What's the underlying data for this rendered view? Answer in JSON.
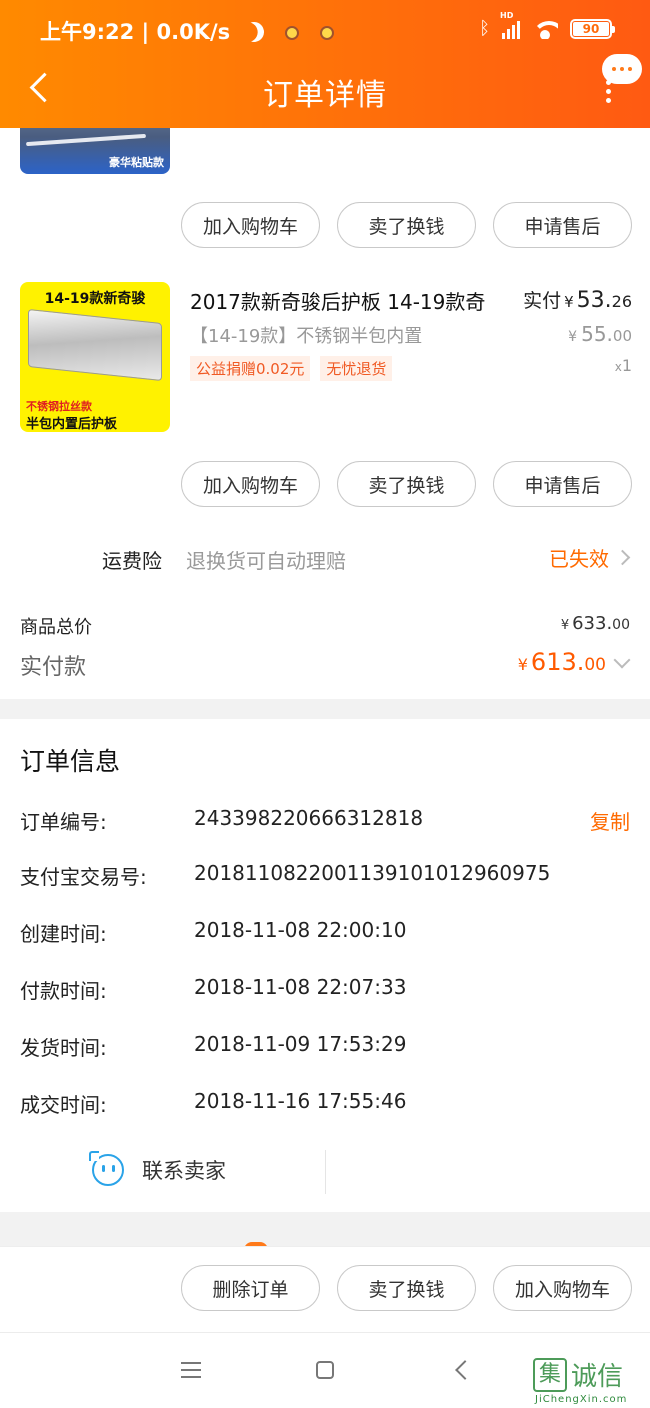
{
  "status_bar": {
    "time": "上午9:22",
    "speed": "0.0K/s",
    "battery": "90",
    "signal_label": "HD"
  },
  "header": {
    "title": "订单详情"
  },
  "product1": {
    "tag": "豪华粘贴款"
  },
  "actions1": [
    "加入购物车",
    "卖了换钱",
    "申请售后"
  ],
  "product2": {
    "img_top": "14-19款新奇骏",
    "img_red": "不锈钢拉丝款",
    "img_bottom": "半包内置后护板",
    "title": "2017款新奇骏后护板 14-19款奇",
    "sku": "【14-19款】不锈钢半包内置",
    "tags": [
      "公益捐赠0.02元",
      "无忧退货"
    ],
    "paid_label": "实付",
    "currency": "¥",
    "paid_int": "53.",
    "paid_dec": "26",
    "orig_int": "55.",
    "orig_dec": "00",
    "qty_prefix": "x",
    "qty": "1"
  },
  "actions2": [
    "加入购物车",
    "卖了换钱",
    "申请售后"
  ],
  "insurance": {
    "label": "运费险",
    "desc": "退换货可自动理赔",
    "status": "已失效"
  },
  "totals": {
    "goods_label": "商品总价",
    "goods_int": "633.",
    "goods_dec": "00",
    "paid_label": "实付款",
    "paid_int": "613.",
    "paid_dec": "00"
  },
  "order_info": {
    "title": "订单信息",
    "copy_label": "复制",
    "rows": [
      {
        "label": "订单编号:",
        "value": "243398220666312818"
      },
      {
        "label": "支付宝交易号:",
        "value": "2018110822001139101012960975"
      },
      {
        "label": "创建时间:",
        "value": "2018-11-08 22:00:10"
      },
      {
        "label": "付款时间:",
        "value": "2018-11-08 22:07:33"
      },
      {
        "label": "发货时间:",
        "value": "2018-11-09 17:53:29"
      },
      {
        "label": "成交时间:",
        "value": "2018-11-16 17:55:46"
      }
    ]
  },
  "contact": {
    "label": "联系卖家"
  },
  "bottom_actions": [
    "删除订单",
    "卖了换钱",
    "加入购物车"
  ],
  "watermark": {
    "char": "集",
    "text": "诚信",
    "sub": "JiChengXin.com"
  }
}
